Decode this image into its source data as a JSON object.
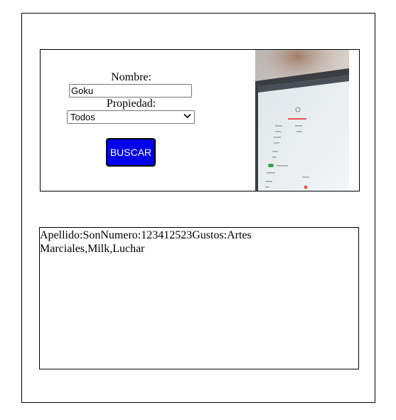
{
  "form": {
    "nombre_label": "Nombre:",
    "nombre_value": "Goku",
    "propiedad_label": "Propiedad:",
    "propiedad_selected": "Todos",
    "search_button_label": "BUSCAR"
  },
  "image": {
    "screen_text_title": "Sign up for free",
    "colors": {
      "background_blur": "#c9c2bd",
      "screen": "#e9eef0",
      "accent": "#e8554e",
      "toggle": "#2fa14a"
    }
  },
  "results": {
    "text": "Apellido:SonNumero:123412523Gustos:Artes Marciales,Milk,Luchar"
  },
  "colors": {
    "button_bg": "#0000ee",
    "button_text": "#ffffff"
  }
}
